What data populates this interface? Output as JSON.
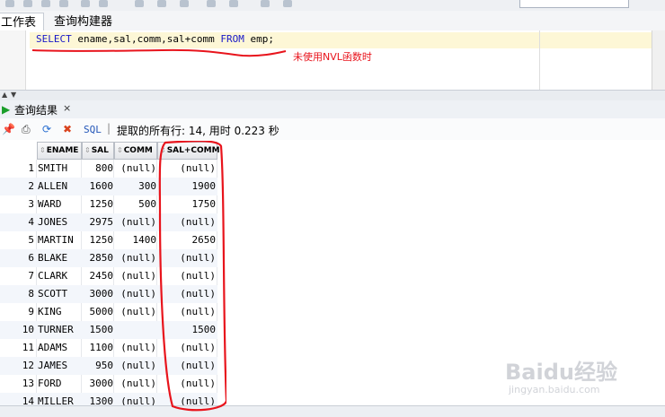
{
  "tabs": [
    "工作表",
    "查询构建器"
  ],
  "editor": {
    "sql_kw1": "SELECT",
    "sql_mid": " ename,sal,comm,sal+comm ",
    "sql_kw2": "FROM",
    "sql_end": " emp;"
  },
  "annotation": "未使用NVL函数时",
  "results_tab": {
    "title": "查询结果",
    "close": "×"
  },
  "toolbar": {
    "sql_label": "SQL",
    "sep": "|",
    "status": "提取的所有行: 14, 用时 0.223 秒"
  },
  "columns": [
    "ENAME",
    "SAL",
    "COMM",
    "SAL+COMM"
  ],
  "rows": [
    {
      "n": "1",
      "ename": "SMITH",
      "sal": "800",
      "comm": "(null)",
      "total": "(null)"
    },
    {
      "n": "2",
      "ename": "ALLEN",
      "sal": "1600",
      "comm": "300",
      "total": "1900"
    },
    {
      "n": "3",
      "ename": "WARD",
      "sal": "1250",
      "comm": "500",
      "total": "1750"
    },
    {
      "n": "4",
      "ename": "JONES",
      "sal": "2975",
      "comm": "(null)",
      "total": "(null)"
    },
    {
      "n": "5",
      "ename": "MARTIN",
      "sal": "1250",
      "comm": "1400",
      "total": "2650"
    },
    {
      "n": "6",
      "ename": "BLAKE",
      "sal": "2850",
      "comm": "(null)",
      "total": "(null)"
    },
    {
      "n": "7",
      "ename": "CLARK",
      "sal": "2450",
      "comm": "(null)",
      "total": "(null)"
    },
    {
      "n": "8",
      "ename": "SCOTT",
      "sal": "3000",
      "comm": "(null)",
      "total": "(null)"
    },
    {
      "n": "9",
      "ename": "KING",
      "sal": "5000",
      "comm": "(null)",
      "total": "(null)"
    },
    {
      "n": "10",
      "ename": "TURNER",
      "sal": "1500",
      "comm": "",
      "total": "1500"
    },
    {
      "n": "11",
      "ename": "ADAMS",
      "sal": "1100",
      "comm": "(null)",
      "total": "(null)"
    },
    {
      "n": "12",
      "ename": "JAMES",
      "sal": "950",
      "comm": "(null)",
      "total": "(null)"
    },
    {
      "n": "13",
      "ename": "FORD",
      "sal": "3000",
      "comm": "(null)",
      "total": "(null)"
    },
    {
      "n": "14",
      "ename": "MILLER",
      "sal": "1300",
      "comm": "(null)",
      "total": "(null)"
    }
  ],
  "watermark": {
    "brand": "Baidu经验",
    "url": "jingyan.baidu.com"
  },
  "colors": {
    "annotation_red": "#e8141c",
    "keyword_blue": "#1717c8",
    "current_line": "#fdf7d6"
  }
}
